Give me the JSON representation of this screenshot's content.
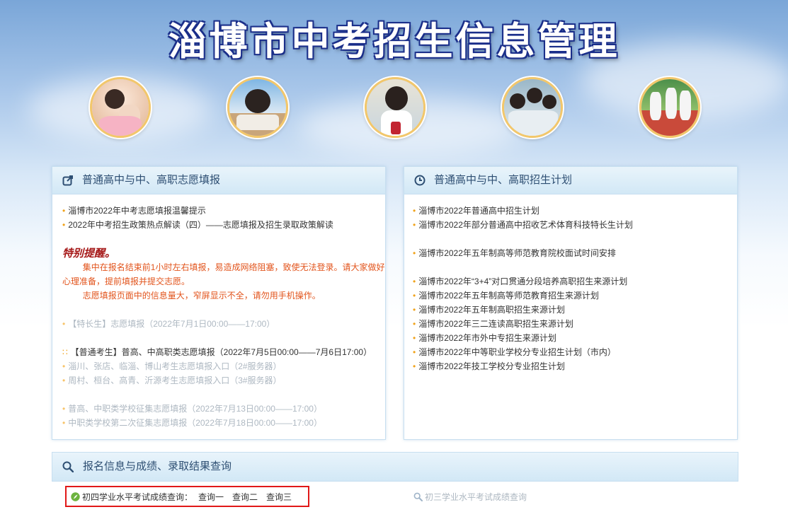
{
  "title": "淄博市中考招生信息管理",
  "images": [
    {
      "name": "mother-child-reading"
    },
    {
      "name": "student-reading-books"
    },
    {
      "name": "student-in-classroom"
    },
    {
      "name": "students-lab"
    },
    {
      "name": "students-running"
    }
  ],
  "left_panel": {
    "title": "普通高中与中、高职志愿填报",
    "top_links": [
      "淄博市2022年中考志愿填报温馨提示",
      "2022年中考招生政策热点解读（四）——志愿填报及招生录取政策解读"
    ],
    "reminder_title": "特别提醒。",
    "reminder_lines": [
      "集中在报名结束前1小时左右填报，易造成网络阻塞，致使无法登录。请大家做好心理准备，提前填报并提交志愿。",
      "志愿填报页面中的信息量大，窄屏显示不全，请勿用手机操作。"
    ],
    "special_link": "【特长生】志愿填报（2022年7月1日00:00——17:00）",
    "normal_title": "【普通考生】普高、中高职类志愿填报（2022年7月5日00:00——7月6日17:00）",
    "normal_links": [
      "淄川、张店、临淄、博山考生志愿填报入口（2#服务器）",
      "周村、桓台、高青、沂源考生志愿填报入口（3#服务器）"
    ],
    "bottom_links": [
      "普高、中职类学校征集志愿填报（2022年7月13日00:00——17:00）",
      "中职类学校第二次征集志愿填报（2022年7月18日00:00——17:00）"
    ]
  },
  "right_panel": {
    "title": "普通高中与中、高职招生计划",
    "links_a": [
      "淄博市2022年普通高中招生计划",
      "淄博市2022年部分普通高中招收艺术体育科技特长生计划"
    ],
    "links_b": [
      "淄博市2022年五年制高等师范教育院校面试时间安排"
    ],
    "links_c": [
      "淄博市2022年“3+4”对口贯通分段培养高职招生来源计划",
      "淄博市2022年五年制高等师范教育招生来源计划",
      "淄博市2022年五年制高职招生来源计划",
      "淄博市2022年三二连读高职招生来源计划",
      "淄博市2022年市外中专招生来源计划",
      "淄博市2022年中等职业学校分专业招生计划（市内）",
      "淄博市2022年技工学校分专业招生计划"
    ]
  },
  "query": {
    "title": "报名信息与成绩、录取结果查询",
    "left_label": "初四学业水平考试成绩查询：",
    "left_links": [
      "查询一",
      "查询二",
      "查询三"
    ],
    "right_label": "初三学业水平考试成绩查询"
  },
  "colors": {
    "accent": "#2e4f73",
    "bullet": "#f0a21a",
    "warning": "#e2541c",
    "highlight_box": "#e11818"
  }
}
